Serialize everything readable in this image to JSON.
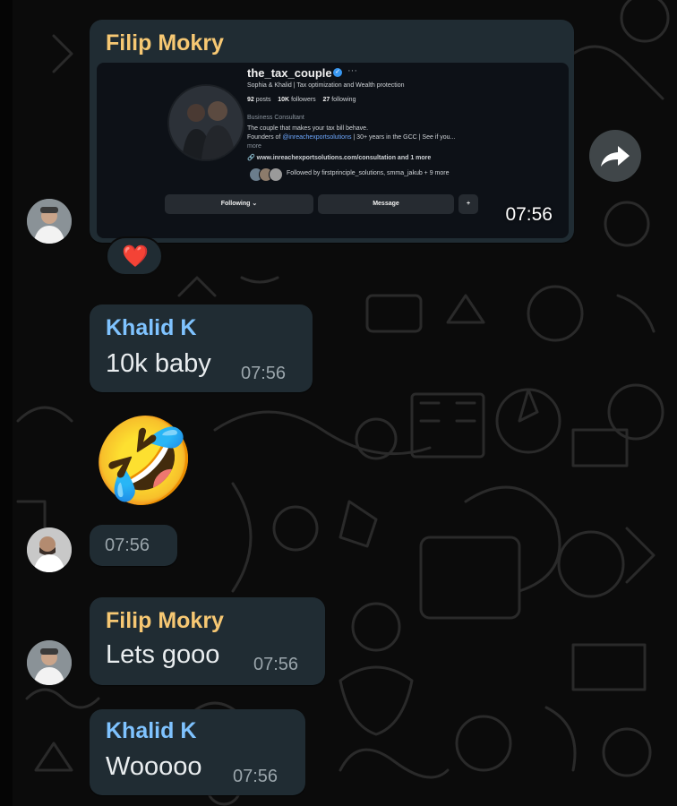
{
  "messages": [
    {
      "sender": "Filip Mokry",
      "time": "07:56",
      "link_preview": {
        "username": "the_tax_couple",
        "bio_line": "Sophia & Khalid | Tax optimization and Wealth protection",
        "posts_count": "92",
        "posts_label": "posts",
        "followers_count": "10K",
        "followers_label": "followers",
        "following_count": "27",
        "following_label": "following",
        "category": "Business Consultant",
        "tagline": "The couple that makes your tax bill behave.",
        "founders_prefix": "Founders of",
        "founders_mention": "@inreachexportsolutions",
        "founders_suffix": "| 30+ years in the GCC | See if you...",
        "more": "more",
        "link": "www.inreachexportsolutions.com/consultation and 1 more",
        "followed_by": "Followed by firstprinciple_solutions, smma_jakub + 9 more",
        "following_button": "Following",
        "message_button": "Message"
      },
      "reaction": "❤️"
    },
    {
      "sender": "Khalid K",
      "text": "10k baby",
      "time": "07:56"
    },
    {
      "emoji": "🤣",
      "time": "07:56"
    },
    {
      "sender": "Filip Mokry",
      "text": "Lets gooo",
      "time": "07:56"
    },
    {
      "sender": "Khalid K",
      "text": "Wooooo",
      "time": "07:56"
    }
  ],
  "colors": {
    "background": "#0b0b0b",
    "bubble": "#202c33",
    "filip_name": "#f7c873",
    "khalid_name": "#7fc3ff",
    "time": "#9aa5ab"
  },
  "icons": [
    "forward-icon",
    "verified-badge-icon",
    "link-icon",
    "add-person-icon"
  ]
}
